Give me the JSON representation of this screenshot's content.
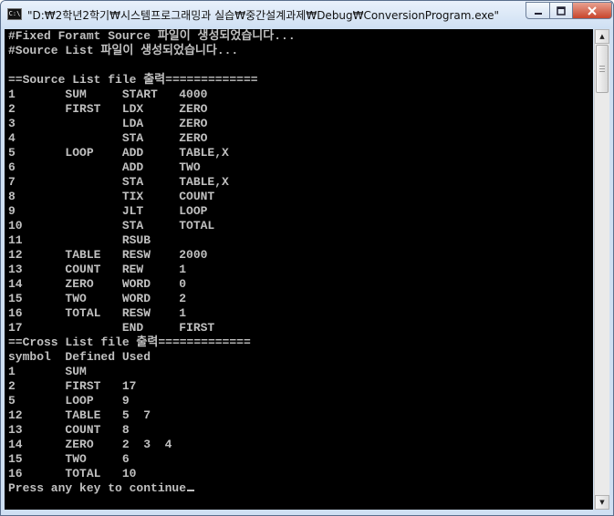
{
  "window": {
    "title": "\"D:₩2학년2학기₩시스템프로그래밍과 실습₩중간설계과제₩Debug₩ConversionProgram.exe\"",
    "app_icon": "C:\\",
    "controls": {
      "minimize": "minimize-icon",
      "maximize": "maximize-icon",
      "close": "close-icon"
    }
  },
  "console": {
    "lines": [
      "#Fixed Foramt Source 파일이 생성되었습니다...",
      "#Source List 파일이 생성되었습니다...",
      "",
      "==Source List file 출력=============",
      "1       SUM     START   4000",
      "2       FIRST   LDX     ZERO",
      "3               LDA     ZERO",
      "4               STA     ZERO",
      "5       LOOP    ADD     TABLE,X",
      "6               ADD     TWO",
      "7               STA     TABLE,X",
      "8               TIX     COUNT",
      "9               JLT     LOOP",
      "10              STA     TOTAL",
      "11              RSUB",
      "12      TABLE   RESW    2000",
      "13      COUNT   REW     1",
      "14      ZERO    WORD    0",
      "15      TWO     WORD    2",
      "16      TOTAL   RESW    1",
      "17              END     FIRST",
      "==Cross List file 출력=============",
      "symbol  Defined Used",
      "1       SUM",
      "2       FIRST   17",
      "5       LOOP    9",
      "12      TABLE   5  7",
      "13      COUNT   8",
      "14      ZERO    2  3  4",
      "15      TWO     6",
      "16      TOTAL   10",
      "Press any key to continue"
    ]
  },
  "scrollbar": {
    "up_icon": "▲",
    "down_icon": "▼"
  },
  "colors": {
    "console_bg": "#000000",
    "console_fg": "#c0c0c0",
    "close_button": "#c8452c"
  }
}
